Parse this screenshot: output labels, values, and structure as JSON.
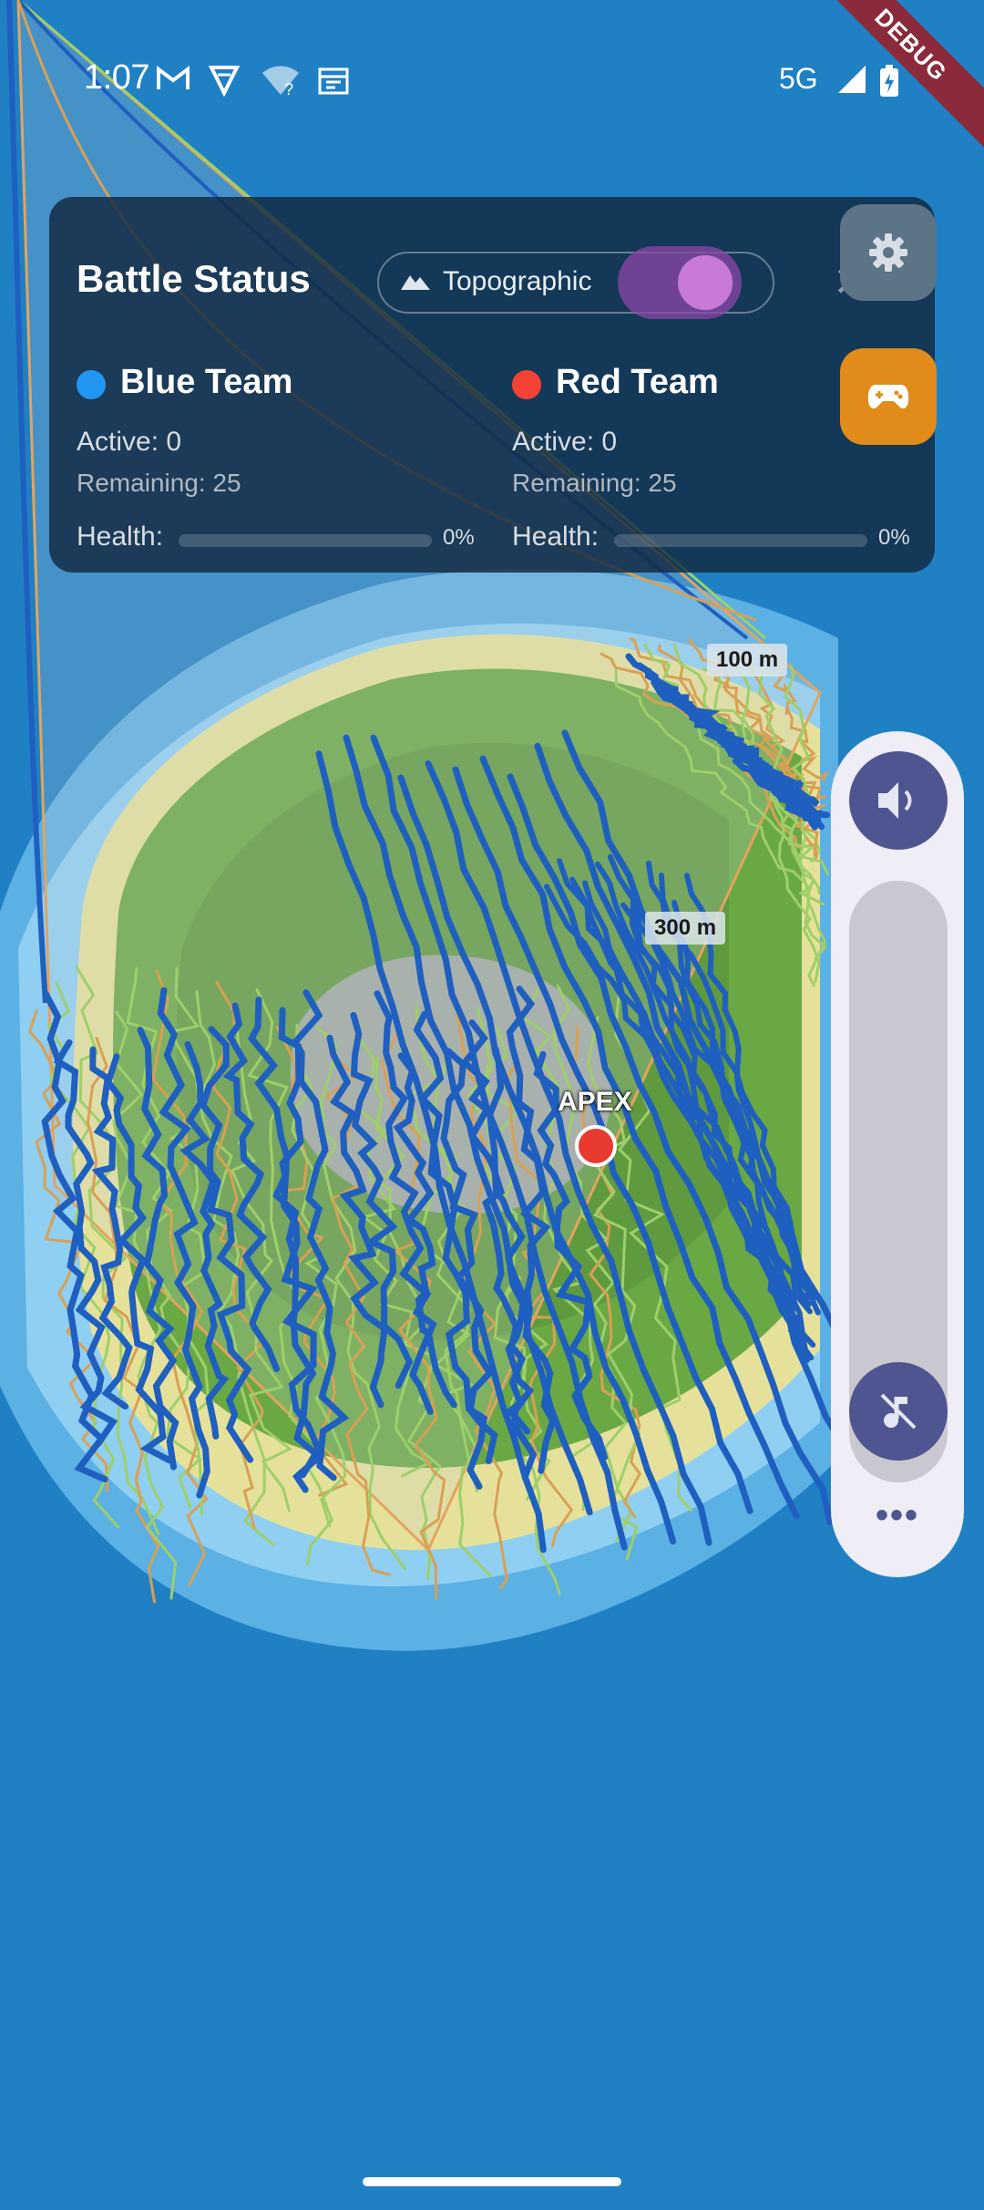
{
  "status_bar": {
    "time": "1:07",
    "network": "5G",
    "icons": [
      "gmail-icon",
      "vpn-shield-icon",
      "wifi-unknown-icon",
      "calendar-icon",
      "signal-icon",
      "battery-charging-icon"
    ]
  },
  "debug_banner": "DEBUG",
  "battle_panel": {
    "title": "Battle Status",
    "map_toggle_label": "Topographic",
    "map_toggle_on": true,
    "blue_team": {
      "name": "Blue Team",
      "color": "#2196f3",
      "active": "Active: 0",
      "remaining": "Remaining: 25",
      "health_label": "Health:",
      "health_pct": "0%",
      "health_value": 0
    },
    "red_team": {
      "name": "Red Team",
      "color": "#f44336",
      "active": "Active: 0",
      "remaining": "Remaining: 25",
      "health_label": "Health:",
      "health_pct": "0%",
      "health_value": 0
    }
  },
  "map": {
    "contour_labels": [
      "100 m",
      "300 m"
    ],
    "apex_label": "APEX",
    "water_color": "#2080c4",
    "blue_trail_color": "#1f5fbf",
    "green_trail_color": "#9ecf6a",
    "orange_trail_color": "#d8a055"
  },
  "volume_panel": {
    "level": 0,
    "more_label": "•••"
  }
}
